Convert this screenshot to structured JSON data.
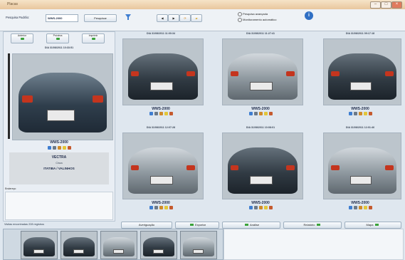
{
  "window": {
    "title": "Placas"
  },
  "toolbar": {
    "search_label": "Pesquisa Padrão:",
    "search_value": "WWS-2000",
    "search_button": "Pesquisar",
    "filter_icon": "funnel-icon",
    "nav_icons": [
      "arrow-left-icon",
      "arrow-right-icon",
      "refresh-icon",
      "folder-icon"
    ],
    "option_1": "Pesquisa avançada",
    "option_2": "Monitoramento automático",
    "info_icon": "info-icon",
    "small_buttons": [
      "Anterior",
      "Próxima",
      "Imprimir"
    ]
  },
  "left_panel": {
    "header": "DIA 31/08/2011 10:33:51",
    "plate": "WWS-2000",
    "make": "VECTRA",
    "color": "Cinza",
    "location": "ITATIBA / VALINHOS",
    "notes_label": "Endereço"
  },
  "tiles": [
    {
      "timestamp": "DIA 31/08/2011 11:00:34",
      "plate": "WWS-2000",
      "car": "dark"
    },
    {
      "timestamp": "DIA 31/08/2011 11:27:41",
      "plate": "WWS-2000",
      "car": "silver"
    },
    {
      "timestamp": "DIA 31/08/2011 09:17:18",
      "plate": "WWS-2000",
      "car": "dark"
    },
    {
      "timestamp": "DIA 31/08/2011 12:07:28",
      "plate": "WWS-2000",
      "car": "silver"
    },
    {
      "timestamp": "DIA 31/08/2011 10:08:01",
      "plate": "WWS-2000",
      "car": "dark"
    },
    {
      "timestamp": "DIA 31/08/2011 12:01:46",
      "plate": "WWS-2000",
      "car": "silver"
    }
  ],
  "bottom": {
    "status": "Visitas encontradas 228 registros",
    "tabs": [
      "Averiguação",
      "Exportar",
      "Análise",
      "Relatório",
      "Mapa"
    ]
  },
  "colors": {
    "accent": "#3aa23a",
    "frame": "#9fb0c0",
    "title_bg": "#e9c79d"
  }
}
